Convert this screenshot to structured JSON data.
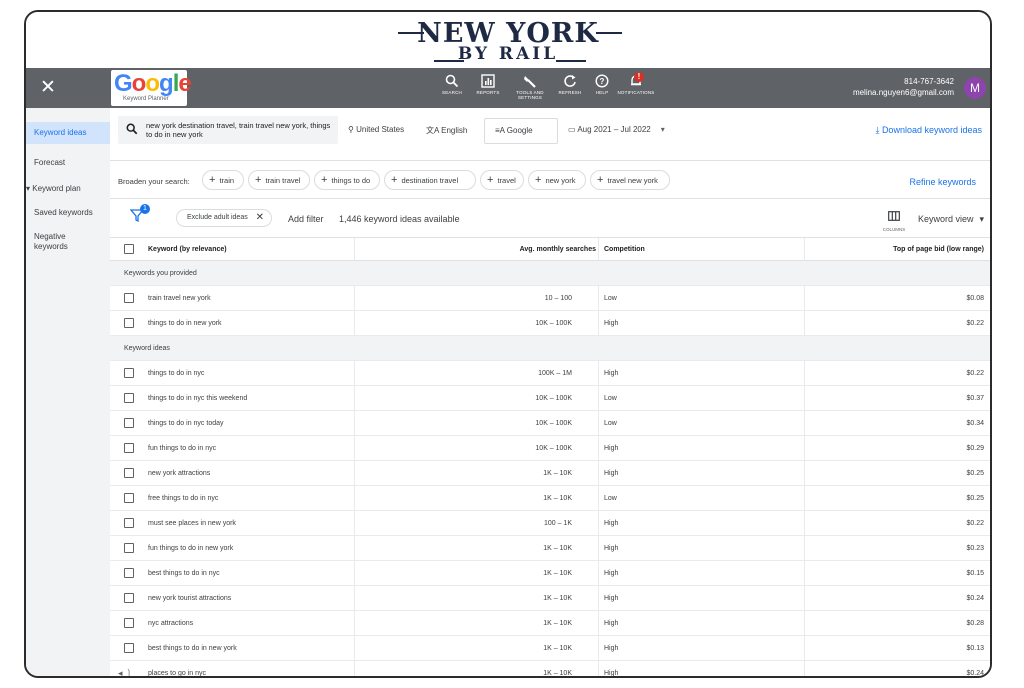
{
  "brand": {
    "line1": "NEW YORK",
    "line2": "BY RAIL"
  },
  "topbar": {
    "logo_text": "Google",
    "logo_sub": "Keyword Planner",
    "tools": [
      {
        "label": "SEARCH",
        "icon": "search-icon"
      },
      {
        "label": "REPORTS",
        "icon": "reports-icon"
      },
      {
        "label": "TOOLS AND SETTINGS",
        "icon": "wrench-icon"
      },
      {
        "label": "REFRESH",
        "icon": "refresh-icon"
      },
      {
        "label": "HELP",
        "icon": "help-icon"
      },
      {
        "label": "NOTIFICATIONS",
        "icon": "bell-icon",
        "badge": "!"
      }
    ],
    "phone": "814-767-3642",
    "email": "melina.nguyen6@gmail.com",
    "avatar_letter": "M"
  },
  "sidebar": {
    "items": [
      {
        "label": "Keyword ideas",
        "active": true
      },
      {
        "label": "Forecast"
      },
      {
        "label": "▾ Keyword plan"
      },
      {
        "label": "Saved keywords"
      },
      {
        "label": "Negative keywords"
      }
    ]
  },
  "toolbar": {
    "search_text": "new york destination travel, train travel new york, things to do in new york",
    "location": "United States",
    "language": "English",
    "engine": "Google",
    "date_range": "Aug 2021 – Jul 2022",
    "download_label": "Download keyword ideas"
  },
  "broaden": {
    "label": "Broaden your search:",
    "chips": [
      "train",
      "train travel",
      "things to do",
      "destination travel",
      "travel",
      "new york",
      "travel new york"
    ],
    "refine_label": "Refine keywords"
  },
  "filters": {
    "badge": "1",
    "adult_chip": "Exclude adult ideas",
    "add_filter": "Add filter",
    "available": "1,446 keyword ideas available",
    "columns_label": "COLUMNS",
    "view_label": "Keyword view"
  },
  "table": {
    "headers": {
      "keyword": "Keyword (by relevance)",
      "searches": "Avg. monthly searches",
      "competition": "Competition",
      "bid": "Top of page bid (low range)"
    },
    "groups": [
      {
        "label": "Keywords you provided",
        "rows": [
          {
            "keyword": "train travel new york",
            "searches": "10 – 100",
            "competition": "Low",
            "bid": "$0.08"
          },
          {
            "keyword": "things to do in new york",
            "searches": "10K – 100K",
            "competition": "High",
            "bid": "$0.22"
          }
        ]
      },
      {
        "label": "Keyword ideas",
        "rows": [
          {
            "keyword": "things to do in nyc",
            "searches": "100K – 1M",
            "competition": "High",
            "bid": "$0.22"
          },
          {
            "keyword": "things to do in nyc this weekend",
            "searches": "10K – 100K",
            "competition": "Low",
            "bid": "$0.37"
          },
          {
            "keyword": "things to do in nyc today",
            "searches": "10K – 100K",
            "competition": "Low",
            "bid": "$0.34"
          },
          {
            "keyword": "fun things to do in nyc",
            "searches": "10K – 100K",
            "competition": "High",
            "bid": "$0.29"
          },
          {
            "keyword": "new york attractions",
            "searches": "1K – 10K",
            "competition": "High",
            "bid": "$0.25"
          },
          {
            "keyword": "free things to do in nyc",
            "searches": "1K – 10K",
            "competition": "Low",
            "bid": "$0.25"
          },
          {
            "keyword": "must see places in new york",
            "searches": "100 – 1K",
            "competition": "High",
            "bid": "$0.22"
          },
          {
            "keyword": "fun things to do in new york",
            "searches": "1K – 10K",
            "competition": "High",
            "bid": "$0.23"
          },
          {
            "keyword": "best things to do in nyc",
            "searches": "1K – 10K",
            "competition": "High",
            "bid": "$0.15"
          },
          {
            "keyword": "new york tourist attractions",
            "searches": "1K – 10K",
            "competition": "High",
            "bid": "$0.24"
          },
          {
            "keyword": "nyc attractions",
            "searches": "1K – 10K",
            "competition": "High",
            "bid": "$0.28"
          },
          {
            "keyword": "best things to do in new york",
            "searches": "1K – 10K",
            "competition": "High",
            "bid": "$0.13"
          },
          {
            "keyword": "places to go in nyc",
            "searches": "1K – 10K",
            "competition": "High",
            "bid": "$0.24"
          }
        ]
      }
    ]
  },
  "colors": {
    "accent": "#1a73e8",
    "topbar": "#5f6368",
    "sidebar": "#f1f3f4",
    "badge": "#d93025",
    "avatar": "#8e44ad"
  }
}
